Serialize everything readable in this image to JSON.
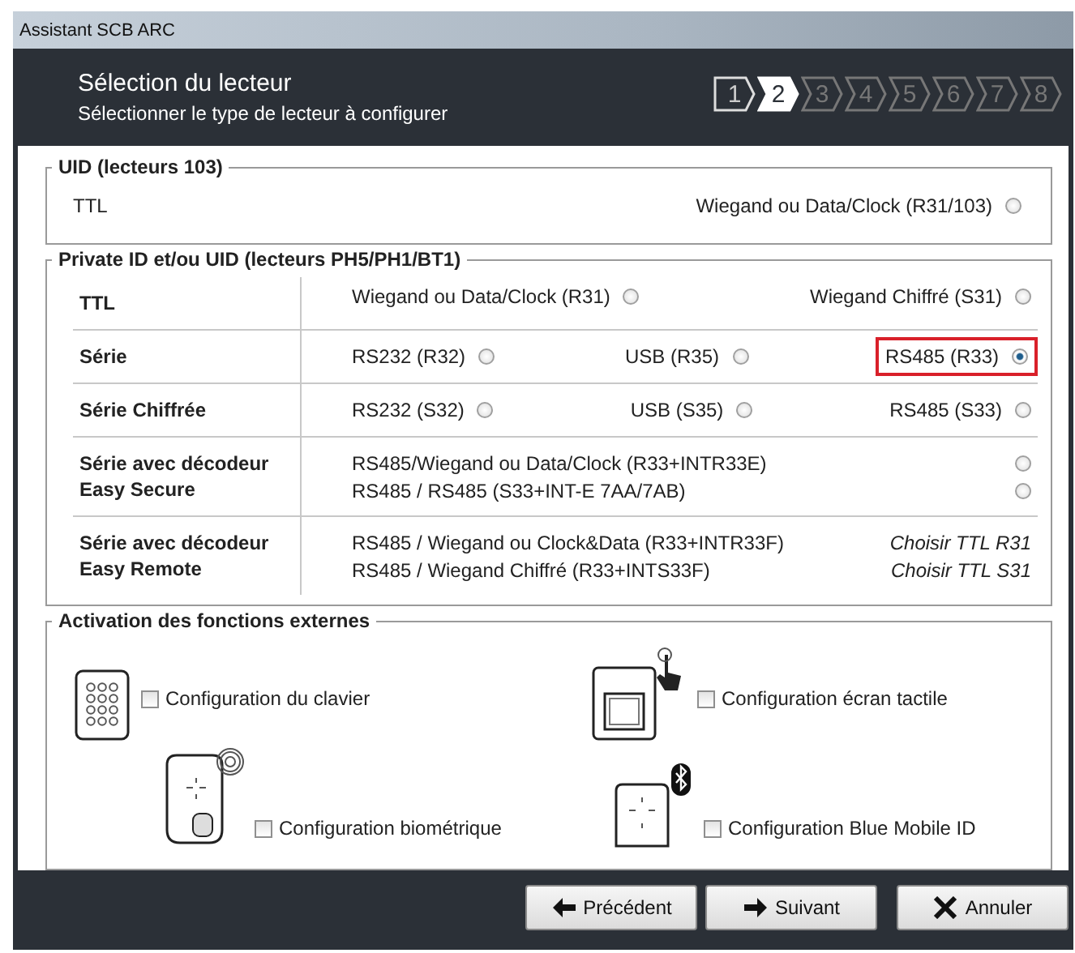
{
  "window": {
    "title": "Assistant SCB ARC"
  },
  "header": {
    "title": "Sélection du lecteur",
    "subtitle": "Sélectionner le type de lecteur à configurer"
  },
  "steps": [
    {
      "label": "1",
      "done": true,
      "selected": false
    },
    {
      "label": "2",
      "done": false,
      "selected": true
    },
    {
      "label": "3",
      "done": false,
      "selected": false
    },
    {
      "label": "4",
      "done": false,
      "selected": false
    },
    {
      "label": "5",
      "done": false,
      "selected": false
    },
    {
      "label": "6",
      "done": false,
      "selected": false
    },
    {
      "label": "7",
      "done": false,
      "selected": false
    },
    {
      "label": "8",
      "done": false,
      "selected": false
    }
  ],
  "sections": [
    {
      "kind": "simple",
      "title": "UID (lecteurs 103)",
      "rows": [
        {
          "label": [
            "TTL"
          ],
          "kind": "inline",
          "options": [
            {
              "kind": "radio",
              "label": "Wiegand ou Data/Clock (R31/103)",
              "selected": false,
              "highlighted": false
            }
          ]
        }
      ]
    },
    {
      "kind": "table",
      "title": "Private ID et/ou UID (lecteurs PH5/PH1/BT1)",
      "rows": [
        {
          "label": [
            "TTL"
          ],
          "kind": "inline",
          "options": [
            {
              "kind": "radio",
              "label": "Wiegand ou Data/Clock (R31)",
              "selected": false,
              "highlighted": false
            },
            {
              "kind": "radio",
              "label": "Wiegand Chiffré (S31)",
              "selected": false,
              "highlighted": false
            }
          ]
        },
        {
          "label": [
            "Série"
          ],
          "kind": "inline",
          "options": [
            {
              "kind": "radio",
              "label": "RS232 (R32)",
              "selected": false,
              "highlighted": false
            },
            {
              "kind": "radio",
              "label": "USB (R35)",
              "selected": false,
              "highlighted": false
            },
            {
              "kind": "radio",
              "label": "RS485 (R33)",
              "selected": true,
              "highlighted": true
            }
          ]
        },
        {
          "label": [
            "Série Chiffrée"
          ],
          "kind": "inline",
          "options": [
            {
              "kind": "radio",
              "label": "RS232 (S32)",
              "selected": false,
              "highlighted": false
            },
            {
              "kind": "radio",
              "label": "USB (S35)",
              "selected": false,
              "highlighted": false
            },
            {
              "kind": "radio",
              "label": "RS485 (S33)",
              "selected": false,
              "highlighted": false
            }
          ]
        },
        {
          "label": [
            "Série avec décodeur",
            "Easy Secure"
          ],
          "kind": "stacked",
          "options": [
            {
              "kind": "radio",
              "label": "RS485/Wiegand ou Data/Clock (R33+INTR33E)",
              "selected": false,
              "highlighted": false
            },
            {
              "kind": "radio",
              "label": "RS485 / RS485 (S33+INT-E 7AA/7AB)",
              "selected": false,
              "highlighted": false
            }
          ]
        },
        {
          "label": [
            "Série avec décodeur",
            "Easy Remote"
          ],
          "kind": "stacked",
          "options": [
            {
              "kind": "hint",
              "label": "RS485 / Wiegand ou Clock&Data (R33+INTR33F)",
              "hint": "Choisir TTL R31"
            },
            {
              "kind": "hint",
              "label": "RS485 / Wiegand Chiffré (R33+INTS33F)",
              "hint": "Choisir TTL S31"
            }
          ]
        }
      ]
    },
    {
      "kind": "features",
      "title": "Activation des fonctions externes",
      "items": [
        {
          "kind": "keypad",
          "label": "Configuration du clavier",
          "checked": false
        },
        {
          "kind": "touch",
          "label": "Configuration écran tactile",
          "checked": false
        },
        {
          "kind": "fingerprint",
          "label": "Configuration biométrique",
          "checked": false
        },
        {
          "kind": "bluetooth",
          "label": "Configuration Blue Mobile ID",
          "checked": false
        }
      ]
    }
  ],
  "buttons": [
    {
      "kind": "back",
      "label": "Précédent"
    },
    {
      "kind": "next",
      "label": "Suivant"
    },
    {
      "kind": "cancel",
      "label": "Annuler"
    }
  ]
}
